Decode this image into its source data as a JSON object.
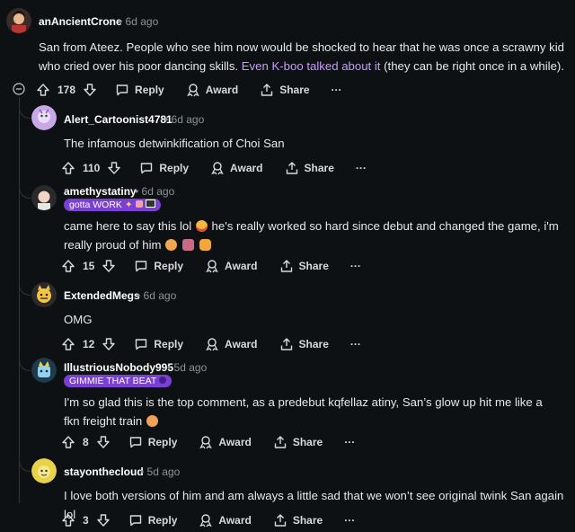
{
  "comments": [
    {
      "user": "anAncientCrone",
      "age": "6d ago",
      "text_before": "San from Ateez. People who see him now would be shocked to hear that he was once a scrawny kid who cried over his poor dancing skills. ",
      "link": "Even K-boo talked about it",
      "text_after": " (they can be right once in a while).",
      "votes": "178"
    },
    {
      "user": "Alert_Cartoonist4781",
      "age": "6d ago",
      "text": "The infamous detwinkification of Choi San",
      "votes": "110"
    },
    {
      "user": "amethystatiny",
      "age": "6d ago",
      "flair": "gotta WORK",
      "text_a": "came here to say this lol",
      "text_b": " he's really worked so hard since debut and changed the game, i'm really proud of him",
      "votes": "15"
    },
    {
      "user": "ExtendedMegs",
      "age": "6d ago",
      "text": "OMG",
      "votes": "12"
    },
    {
      "user": "IllustriousNobody995",
      "age": "5d ago",
      "flair": "GIMMIE THAT BEAT",
      "text": "I'm so glad this is the top comment, as a predebut kqfellaz atiny, San’s glow up hit me like a fkn freight train",
      "votes": "8"
    },
    {
      "user": "stayonthecloud",
      "age": "5d ago",
      "text": "I love both versions of him and am always a little sad that we won’t see original twink San again lol",
      "votes": "3"
    }
  ],
  "actions": {
    "reply": "Reply",
    "award": "Award",
    "share": "Share",
    "more": "···",
    "dot": "•"
  },
  "colors": {
    "background": "#0e1113",
    "link": "#c79bff",
    "flair": "#7b3fd6"
  }
}
